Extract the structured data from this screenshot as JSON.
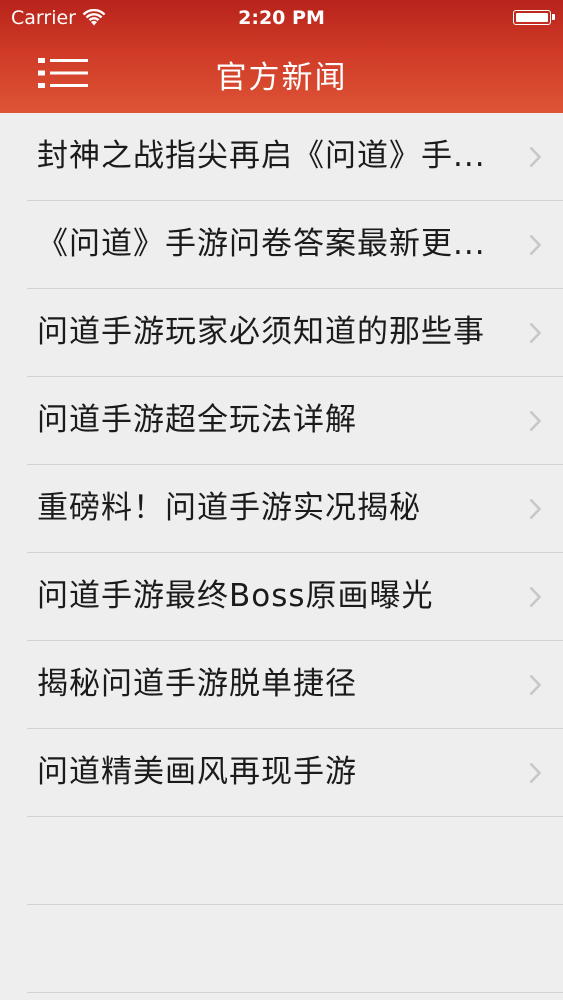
{
  "status_bar": {
    "carrier": "Carrier",
    "time": "2:20 PM"
  },
  "nav": {
    "title": "官方新闻",
    "menu_icon": "hamburger-menu-icon"
  },
  "news": [
    {
      "title": "封神之战指尖再启《问道》手..."
    },
    {
      "title": "《问道》手游问卷答案最新更..."
    },
    {
      "title": "问道手游玩家必须知道的那些事"
    },
    {
      "title": "问道手游超全玩法详解"
    },
    {
      "title": "重磅料！问道手游实况揭秘"
    },
    {
      "title": "问道手游最终Boss原画曝光"
    },
    {
      "title": "揭秘问道手游脱单捷径"
    },
    {
      "title": "问道精美画风再现手游"
    }
  ],
  "colors": {
    "header": "#cf3a27",
    "background": "#efeeee",
    "separator": "#d3d1d1",
    "chevron": "#c7c7cc"
  }
}
